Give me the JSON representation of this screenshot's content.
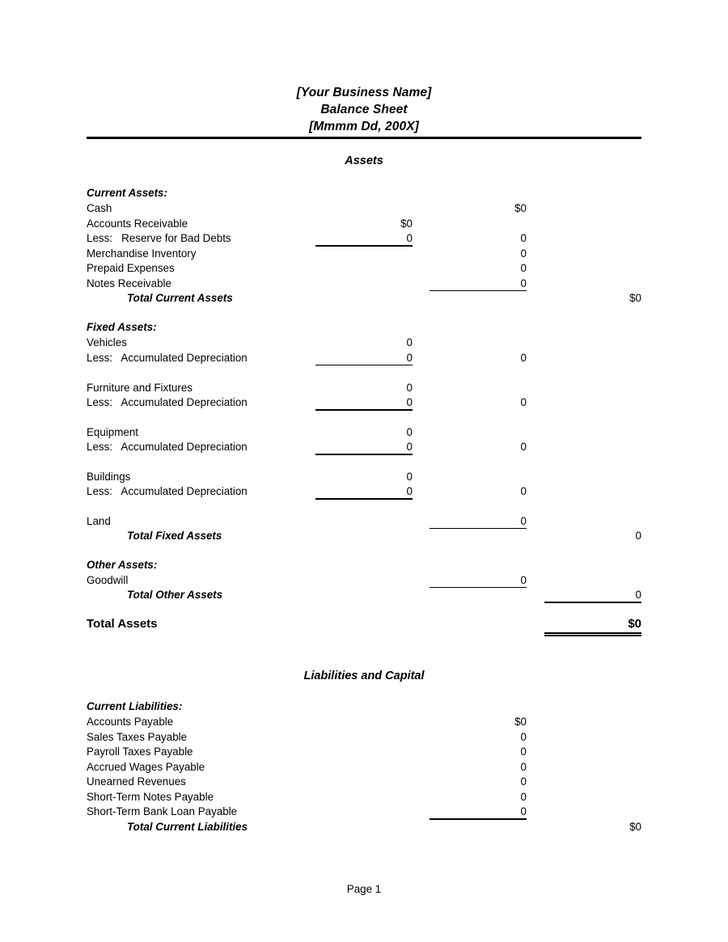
{
  "document": {
    "title_lines": [
      "[Your Business Name]",
      "Balance Sheet",
      "[Mmmm Dd, 200X]"
    ],
    "footer": "Page 1"
  },
  "sections": {
    "assets_heading": "Assets",
    "liabilities_heading": "Liabilities and Capital"
  },
  "current_assets": {
    "group_label": "Current Assets:",
    "rows": [
      {
        "label": "Cash",
        "c1": "",
        "c2": "$0",
        "c3": ""
      },
      {
        "label": "Accounts Receivable",
        "c1": "$0",
        "c2": "",
        "c3": ""
      },
      {
        "label": "Less:   Reserve for Bad Debts",
        "c1": "0",
        "c2": "0",
        "c3": ""
      },
      {
        "label": "Merchandise Inventory",
        "c1": "",
        "c2": "0",
        "c3": ""
      },
      {
        "label": "Prepaid Expenses",
        "c1": "",
        "c2": "0",
        "c3": ""
      },
      {
        "label": "Notes Receivable",
        "c1": "",
        "c2": "0",
        "c3": ""
      }
    ],
    "total_label": "Total Current Assets",
    "total_value": "$0"
  },
  "fixed_assets": {
    "group_label": "Fixed Assets:",
    "pairs": [
      {
        "asset_label": "Vehicles",
        "asset_value": "0",
        "less_label": "Less:   Accumulated Depreciation",
        "less_value": "0",
        "net_value": "0"
      },
      {
        "asset_label": "Furniture and Fixtures",
        "asset_value": "0",
        "less_label": "Less:   Accumulated Depreciation",
        "less_value": "0",
        "net_value": "0"
      },
      {
        "asset_label": "Equipment",
        "asset_value": "0",
        "less_label": "Less:   Accumulated Depreciation",
        "less_value": "0",
        "net_value": "0"
      },
      {
        "asset_label": "Buildings",
        "asset_value": "0",
        "less_label": "Less:   Accumulated Depreciation",
        "less_value": "0",
        "net_value": "0"
      }
    ],
    "land_label": "Land",
    "land_value": "0",
    "total_label": "Total Fixed Assets",
    "total_value": "0"
  },
  "other_assets": {
    "group_label": "Other Assets:",
    "goodwill_label": "Goodwill",
    "goodwill_value": "0",
    "total_label": "Total Other Assets",
    "total_value": "0"
  },
  "total_assets": {
    "label": "Total Assets",
    "value": "$0"
  },
  "current_liabilities": {
    "group_label": "Current Liabilities:",
    "rows": [
      {
        "label": "Accounts Payable",
        "c2": "$0"
      },
      {
        "label": "Sales Taxes Payable",
        "c2": "0"
      },
      {
        "label": "Payroll Taxes Payable",
        "c2": "0"
      },
      {
        "label": "Accrued Wages Payable",
        "c2": "0"
      },
      {
        "label": "Unearned Revenues",
        "c2": "0"
      },
      {
        "label": "Short-Term Notes Payable",
        "c2": "0"
      },
      {
        "label": "Short-Term Bank Loan Payable",
        "c2": "0"
      }
    ],
    "total_label": "Total Current Liabilities",
    "total_value": "$0"
  }
}
